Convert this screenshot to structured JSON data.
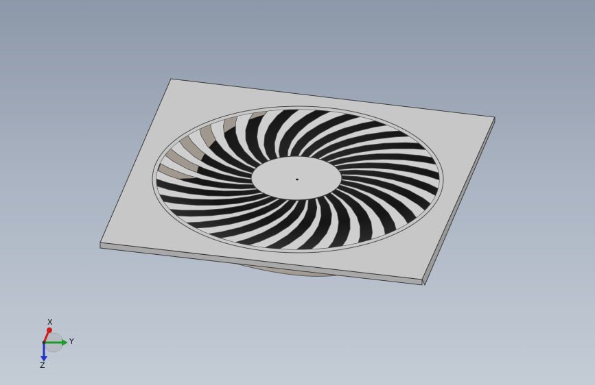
{
  "viewport": {
    "background_top": "#8c97a8",
    "background_bottom": "#c4ccd6"
  },
  "model": {
    "name": "swirl-diffuser",
    "face_color": "#c7c7c7",
    "edge_color": "#3a3a3a",
    "blade_count": 28,
    "blade_color": "#cfcfcf",
    "slot_dark_color": "#1e1e1e"
  },
  "triad": {
    "x_label": "X",
    "y_label": "Y",
    "z_label": "Z",
    "x_color": "#d21c1c",
    "y_color": "#1f9a2a",
    "z_color": "#2133c8"
  }
}
